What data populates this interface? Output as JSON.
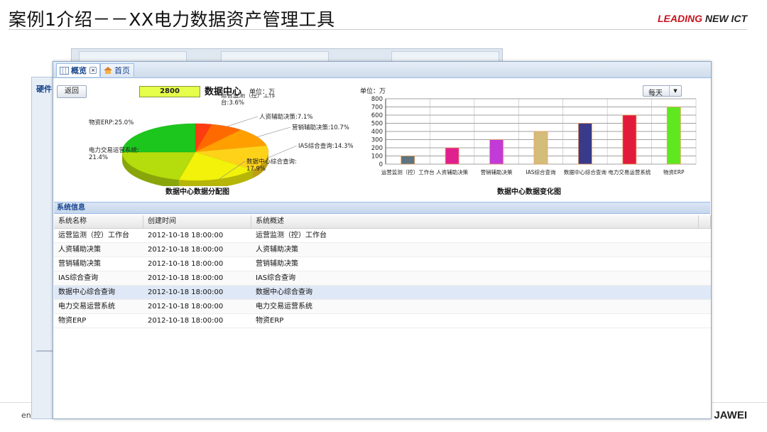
{
  "slide": {
    "title": "案例1介绍－－XX电力数据资产管理工具",
    "logo_a": "LEADING",
    "logo_b": "NEW ICT",
    "footer_left": "en",
    "footer_right": "JAWEI"
  },
  "background_window": {
    "label": "硬件"
  },
  "tabs": [
    {
      "label": "概览",
      "icon": "grid-icon",
      "active": true
    },
    {
      "label": "首页",
      "icon": "home-icon",
      "active": false
    }
  ],
  "toolbar": {
    "back_label": "返回",
    "value": "2800",
    "dashboard_title": "数据中心",
    "unit_left": "单位：万",
    "unit_right": "单位：万",
    "period_select": "每天"
  },
  "colors": {
    "accent": "#15428b",
    "brand_red": "#c8141e"
  },
  "chart_data": [
    {
      "type": "pie",
      "title": "数据中心数据分配图",
      "slices": [
        {
          "label": "运营监测（控）工作台",
          "value": 3.6,
          "display": "运营监测（控）工作台:3.6%",
          "color": "#ff3b12"
        },
        {
          "label": "人资辅助决策",
          "value": 7.1,
          "display": "人资辅助决策:7.1%",
          "color": "#ff6a00"
        },
        {
          "label": "营销辅助决策",
          "value": 10.7,
          "display": "营销辅助决策:10.7%",
          "color": "#ff9f00"
        },
        {
          "label": "IAS综合查询",
          "value": 14.3,
          "display": "IAS综合查询:14.3%",
          "color": "#ffd21a"
        },
        {
          "label": "数据中心综合查询",
          "value": 17.9,
          "display": "数据中心综合查询:17.9%",
          "color": "#f2f20a"
        },
        {
          "label": "电力交易运营系统",
          "value": 21.4,
          "display": "电力交易运营系统:21.4%",
          "color": "#b5dc0c"
        },
        {
          "label": "物资ERP",
          "value": 25.0,
          "display": "物资ERP:25.0%",
          "color": "#1cc61c"
        }
      ]
    },
    {
      "type": "bar",
      "title": "数据中心数据变化图",
      "ylabel": "单位：万",
      "ylim": [
        0,
        800
      ],
      "yticks": [
        0,
        100,
        200,
        300,
        400,
        500,
        600,
        700,
        800
      ],
      "grid": true,
      "categories": [
        "运营监测（控）工作台",
        "人资辅助决策",
        "营销辅助决策",
        "IAS综合查询",
        "数据中心综合查询",
        "电力交易运营系统",
        "物资ERP"
      ],
      "values": [
        100,
        200,
        300,
        400,
        500,
        600,
        700
      ],
      "colors": [
        "#5e7480",
        "#e0208e",
        "#c23bd8",
        "#d4bc7a",
        "#3a3a8a",
        "#e21b3a",
        "#5fe820"
      ]
    }
  ],
  "sysinfo": {
    "header": "系统信息",
    "columns": [
      "系统名称",
      "创建时间",
      "系统概述"
    ],
    "rows": [
      [
        "运营监测（控）工作台",
        "2012-10-18 18:00:00",
        "运营监测（控）工作台"
      ],
      [
        "人资辅助决策",
        "2012-10-18 18:00:00",
        "人资辅助决策"
      ],
      [
        "营销辅助决策",
        "2012-10-18 18:00:00",
        "营销辅助决策"
      ],
      [
        "IAS综合查询",
        "2012-10-18 18:00:00",
        "IAS综合查询"
      ],
      [
        "数据中心综合查询",
        "2012-10-18 18:00:00",
        "数据中心综合查询"
      ],
      [
        "电力交易运营系统",
        "2012-10-18 18:00:00",
        "电力交易运营系统"
      ],
      [
        "物资ERP",
        "2012-10-18 18:00:00",
        "物资ERP"
      ]
    ],
    "selected_row": 4
  }
}
